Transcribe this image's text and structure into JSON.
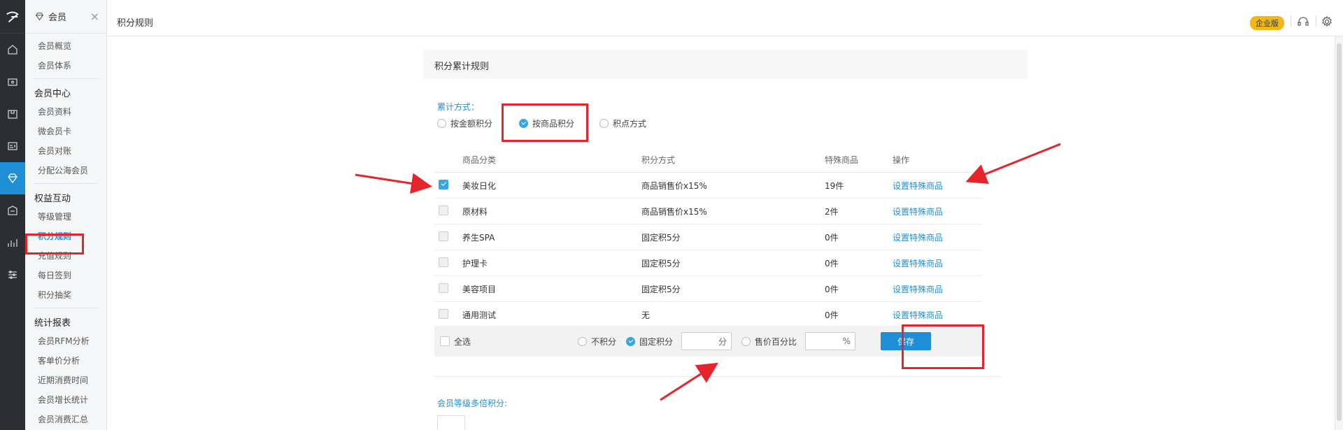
{
  "submenu": {
    "title": "会员",
    "groups": [
      {
        "label": "",
        "items": [
          "会员概览",
          "会员体系"
        ]
      },
      {
        "label": "会员中心",
        "items": [
          "会员资料",
          "微会员卡",
          "会员对账",
          "分配公海会员"
        ]
      },
      {
        "label": "权益互动",
        "items": [
          "等级管理",
          "积分规则",
          "充值规则",
          "每日签到",
          "积分抽奖"
        ]
      },
      {
        "label": "统计报表",
        "items": [
          "会员RFM分析",
          "客单价分析",
          "近期消费时间",
          "会员增长统计",
          "会员消费汇总"
        ]
      }
    ]
  },
  "topbar": {
    "title": "积分规则",
    "badge": "企业版"
  },
  "main": {
    "section_title": "积分累计规则",
    "mode_label": "累计方式：",
    "modes": [
      {
        "label": "按金额积分",
        "selected": false
      },
      {
        "label": "按商品积分",
        "selected": true
      },
      {
        "label": "积点方式",
        "selected": false
      }
    ],
    "table": {
      "headers": [
        "商品分类",
        "积分方式",
        "特殊商品",
        "操作"
      ],
      "rows": [
        {
          "category": "美妆日化",
          "method": "商品销售价x15%",
          "special": "19件",
          "action": "设置特殊商品",
          "checked": true
        },
        {
          "category": "原材料",
          "method": "商品销售价x15%",
          "special": "2件",
          "action": "设置特殊商品",
          "checked": false
        },
        {
          "category": "养生SPA",
          "method": "固定积5分",
          "special": "0件",
          "action": "设置特殊商品",
          "checked": false
        },
        {
          "category": "护理卡",
          "method": "固定积5分",
          "special": "0件",
          "action": "设置特殊商品",
          "checked": false
        },
        {
          "category": "美容项目",
          "method": "固定积5分",
          "special": "0件",
          "action": "设置特殊商品",
          "checked": false
        },
        {
          "category": "通用测试",
          "method": "无",
          "special": "0件",
          "action": "设置特殊商品",
          "checked": false
        }
      ]
    },
    "footer": {
      "select_all": "全选",
      "opt_none": "不积分",
      "opt_fixed": "固定积分",
      "fixed_unit": "分",
      "opt_percent": "售价百分比",
      "percent_unit": "%",
      "save": "保存"
    },
    "level_label": "会员等级多倍积分:"
  },
  "colors": {
    "accent": "#1e8fd6",
    "annotation": "#e5252b",
    "badge": "#f2b816"
  }
}
